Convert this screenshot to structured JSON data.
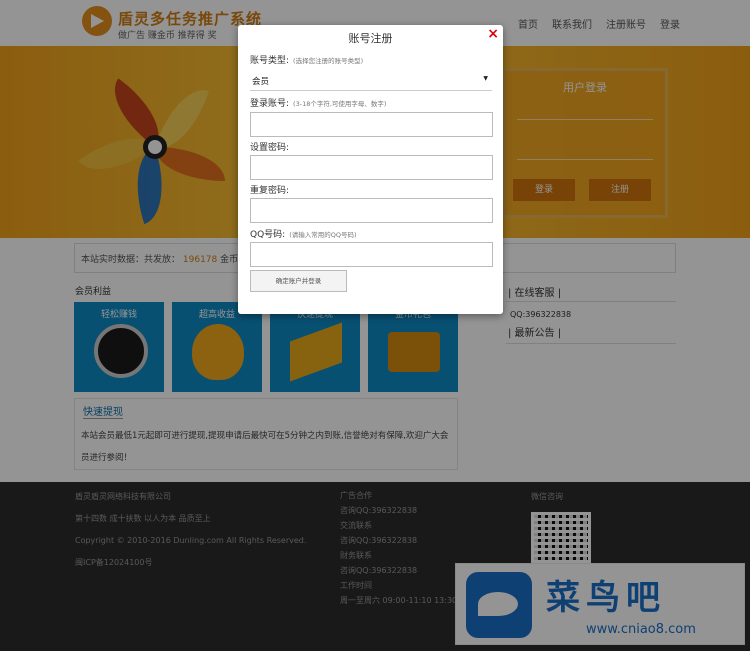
{
  "header": {
    "title": "盾灵多任务推广系统",
    "subtitle": "做广告 赚金币 推荐得 奖",
    "nav": [
      "首页",
      "联系我们",
      "注册账号",
      "登录"
    ]
  },
  "banner": {
    "login_title": "用户登录",
    "login_button": "登录",
    "cancel_button": "注册"
  },
  "stats": {
    "prefix": "本站实时数据：共发放：",
    "value": "196178",
    "unit": "金币"
  },
  "benefits": {
    "label": "会员利益",
    "tiles": [
      "轻松赚钱",
      "超高收益",
      "快速提现",
      "金币礼包"
    ]
  },
  "quick": {
    "title": "快速提现",
    "text": "本站会员最低1元起即可进行提现,提现申请后最快可在5分钟之内到账,信誉绝对有保障,欢迎广大会员进行参阅！"
  },
  "side": {
    "service": "| 在线客服 |",
    "phone": "QQ:396322838",
    "notice": "| 最新公告 |"
  },
  "footer": {
    "col1": [
      "盾灵盾灵网络科技有限公司",
      "第十四数 成十扶数 以人为本 品质至上",
      "Copyright © 2010-2016 Dunling.com All Rights Reserved.",
      "闽ICP备12024100号"
    ],
    "col2": [
      "广告合作",
      "咨询QQ:396322838",
      "交流联系",
      "咨询QQ:396322838",
      "财务联系",
      "咨询QQ:396322838",
      "工作时间",
      "周一至周六 09:00-11:10 13:30"
    ],
    "wechat": "微信咨询"
  },
  "watermark": {
    "text": "菜鸟吧",
    "url": "www.cniao8.com"
  },
  "modal": {
    "title": "账号注册",
    "close": "×",
    "account_type_label": "账号类型:",
    "account_type_hint": "(选择您注册的账号类型)",
    "account_type_value": "会员",
    "account_label": "登录账号:",
    "account_hint": "(3-18个字符,可使用字母、数字)",
    "password_label": "设置密码:",
    "confirm_label": "重复密码:",
    "qq_label": "QQ号码:",
    "qq_hint": "(请输入常用的QQ号码)",
    "submit_button": "确定账户并登录",
    "account_value": "",
    "password_value": "",
    "confirm_value": "",
    "qq_value": ""
  }
}
